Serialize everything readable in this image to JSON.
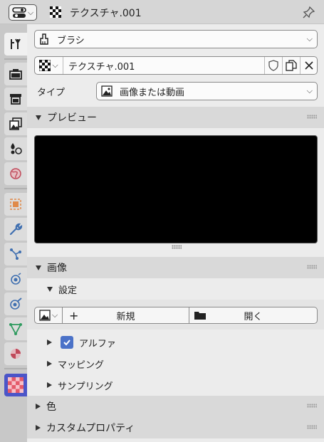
{
  "header": {
    "title": "テクスチャ.001",
    "editor_icon": "properties-editor-icon",
    "pin_icon": "pin-icon"
  },
  "tabs": [
    {
      "name": "tool",
      "icon": "tool-icon"
    },
    {
      "name": "render",
      "icon": "render-icon"
    },
    {
      "name": "output",
      "icon": "output-icon"
    },
    {
      "name": "view-layer",
      "icon": "view-layer-icon"
    },
    {
      "name": "scene",
      "icon": "scene-icon"
    },
    {
      "name": "world",
      "icon": "world-icon"
    },
    {
      "name": "object",
      "icon": "object-icon"
    },
    {
      "name": "modifier",
      "icon": "wrench-icon"
    },
    {
      "name": "particles",
      "icon": "particles-icon"
    },
    {
      "name": "physics",
      "icon": "physics-icon"
    },
    {
      "name": "constraints",
      "icon": "constraint-icon"
    },
    {
      "name": "data",
      "icon": "data-icon"
    },
    {
      "name": "material",
      "icon": "material-icon"
    },
    {
      "name": "texture",
      "icon": "texture-icon",
      "active": true
    }
  ],
  "context": {
    "label": "ブラシ"
  },
  "texture_selector": {
    "name": "テクスチャ.001"
  },
  "type_row": {
    "label": "タイプ",
    "value": "画像または動画"
  },
  "preview": {
    "title": "プレビュー"
  },
  "image_panel": {
    "title": "画像",
    "settings_title": "設定",
    "new_label": "新規",
    "open_label": "開く"
  },
  "subpanels": {
    "alpha": {
      "label": "アルファ",
      "checked": true
    },
    "mapping": {
      "label": "マッピング"
    },
    "sampling": {
      "label": "サンプリング"
    }
  },
  "color_panel": {
    "title": "色"
  },
  "custom_props_panel": {
    "title": "カスタムプロパティ"
  },
  "colors": {
    "accent": "#4b72c8",
    "texture_tab": "#4b55c8"
  }
}
